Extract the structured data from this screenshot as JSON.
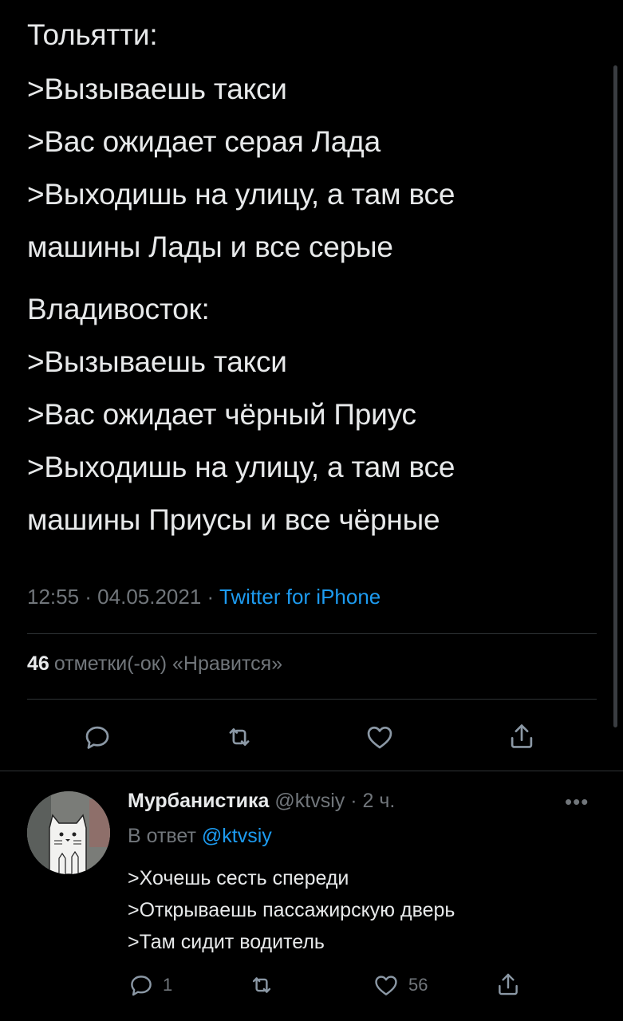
{
  "tweet": {
    "lines": [
      "Тольятти:",
      ">Вызываешь такси",
      ">Вас ожидает серая Лада",
      ">Выходишь на улицу, а там все",
      "машины Лады и все серые",
      "Владивосток:",
      ">Вызываешь такси",
      ">Вас ожидает чёрный Приус",
      ">Выходишь на улицу, а там все",
      "машины Приусы и все чёрные"
    ],
    "time": "12:55 · 04.05.2021 · ",
    "source": "Twitter for iPhone",
    "likes_count": "46",
    "likes_label": "отметки(-ок) «Нравится»"
  },
  "actions": {
    "reply_icon": "reply-icon",
    "retweet_icon": "retweet-icon",
    "like_icon": "heart-icon",
    "share_icon": "share-icon"
  },
  "reply": {
    "display_name": "Мурбанистика",
    "handle_time": " @ktvsiy · 2 ч.",
    "reply_prefix": "В ответ ",
    "reply_mention": "@ktvsiy",
    "more": "•••",
    "lines": [
      ">Хочешь сесть спереди",
      ">Открываешь пассажирскую дверь",
      ">Там сидит водитель"
    ],
    "reply_count": "1",
    "like_count": "56"
  },
  "colors": {
    "background": "#000000",
    "text": "#e7e9ea",
    "muted": "#71767b",
    "accent": "#1d9bf0",
    "divider": "#2f3336"
  }
}
